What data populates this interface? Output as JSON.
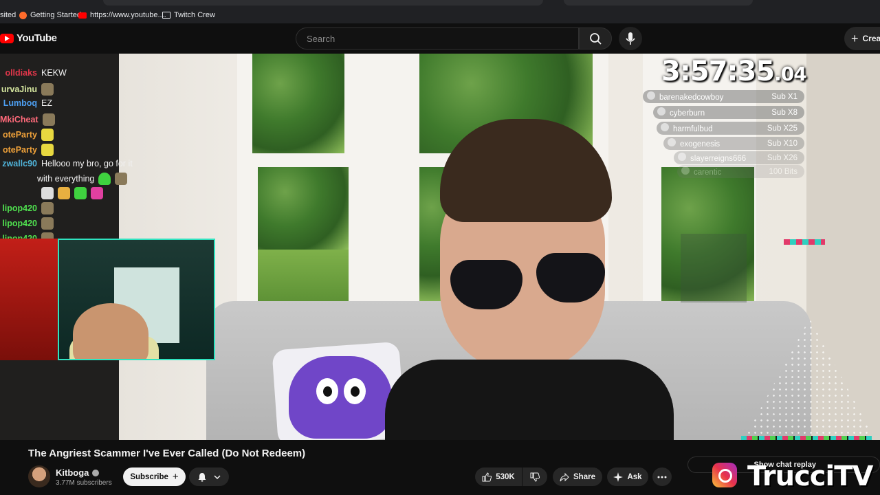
{
  "browser": {
    "bookmarks": [
      {
        "label": "sited",
        "icon": "none"
      },
      {
        "label": "Getting Started",
        "icon": "firefox-icon"
      },
      {
        "label": "https://www.youtube....",
        "icon": "youtube-icon"
      },
      {
        "label": "Twitch Crew",
        "icon": "folder-icon"
      }
    ]
  },
  "youtube": {
    "logo": "YouTube",
    "search_placeholder": "Search",
    "create_label": "Crea"
  },
  "overlay": {
    "timer_main": "3:57:35",
    "timer_ms": ".04",
    "subs": [
      {
        "name": "barenakedcowboy",
        "tier": "Sub X1"
      },
      {
        "name": "cyberburn",
        "tier": "Sub X8"
      },
      {
        "name": "harmfulbud",
        "tier": "Sub X25"
      },
      {
        "name": "exogenesis",
        "tier": "Sub X10"
      },
      {
        "name": "slayerreigns666",
        "tier": "Sub X26"
      },
      {
        "name": "carentic",
        "tier": "100 Bits"
      }
    ],
    "chat": [
      {
        "user": "olldiaks",
        "msg": "KEKW",
        "color": "#e0364a"
      },
      {
        "user": "urvaJinu",
        "msg": "",
        "color": "#d7e8a0"
      },
      {
        "user": "Lumboq",
        "msg": "EZ",
        "color": "#4d9ef0"
      },
      {
        "user": "MkiCheat",
        "msg": "",
        "color": "#ff6a7a"
      },
      {
        "user": "oteParty",
        "msg": "",
        "color": "#f0a23a"
      },
      {
        "user": "oteParty",
        "msg": "",
        "color": "#f0a23a"
      },
      {
        "user": "zwallc90",
        "msg": "Hellooo my bro, go for it",
        "color": "#4fb2d8"
      },
      {
        "user": "",
        "msg": "with everything",
        "color": "#f1f1f1"
      },
      {
        "user": "lipop420",
        "msg": "",
        "color": "#4fe04f"
      },
      {
        "user": "lipop420",
        "msg": "",
        "color": "#4fe04f"
      },
      {
        "user": "lipop420",
        "msg": "",
        "color": "#4fe04f"
      }
    ]
  },
  "video": {
    "title": "The Angriest Scammer I've Ever Called (Do Not Redeem)",
    "channel": "Kitboga",
    "subscribers": "3.77M subscribers",
    "subscribe_label": "Subscribe",
    "likes": "530K",
    "share_label": "Share",
    "ask_label": "Ask",
    "chat_replay_label": "Show chat replay",
    "brand_watermark": "TrucciTV"
  }
}
